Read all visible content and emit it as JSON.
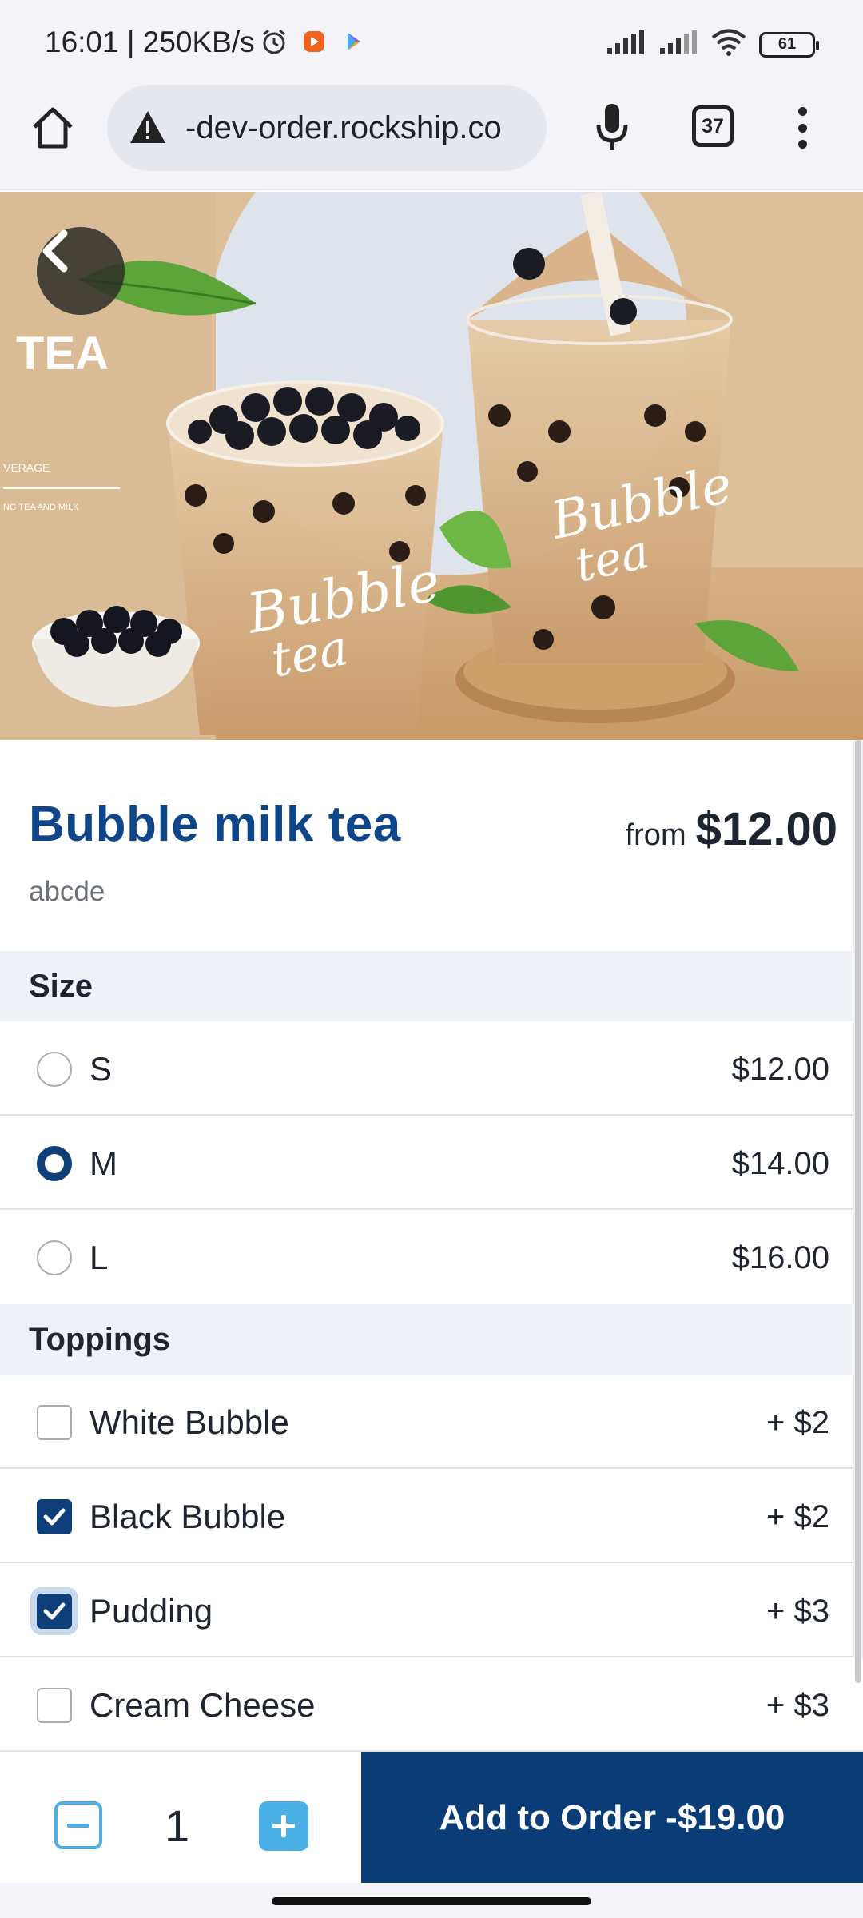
{
  "status_bar": {
    "time": "16:01 | 250KB/s",
    "battery": "61"
  },
  "browser": {
    "url": "-dev-order.rockship.co",
    "tab_count": "37"
  },
  "product": {
    "name": "Bubble milk tea",
    "price_prefix": "from",
    "price": "$12.00",
    "description": "abcde"
  },
  "size": {
    "title": "Size",
    "options": [
      {
        "label": "S",
        "price": "$12.00",
        "selected": false
      },
      {
        "label": "M",
        "price": "$14.00",
        "selected": true
      },
      {
        "label": "L",
        "price": "$16.00",
        "selected": false
      }
    ]
  },
  "toppings": {
    "title": "Toppings",
    "options": [
      {
        "label": "White Bubble",
        "price": "+ $2",
        "checked": false
      },
      {
        "label": "Black Bubble",
        "price": "+ $2",
        "checked": true
      },
      {
        "label": "Pudding",
        "price": "+ $3",
        "checked": true
      },
      {
        "label": "Cream Cheese",
        "price": "+ $3",
        "checked": false
      }
    ]
  },
  "order": {
    "quantity": "1",
    "add_label": "Add to Order -$19.00"
  },
  "hero_image": {
    "text_tea": "TEA",
    "text_verage": "VERAGE",
    "text_small": "NG TEA AND MILK",
    "cup_brand": "Bubble tea"
  },
  "colors": {
    "brand_navy": "#0e4689",
    "button_navy": "#0a3d78",
    "accent_blue": "#4ab0e6",
    "section_bg": "#eef2f6"
  }
}
